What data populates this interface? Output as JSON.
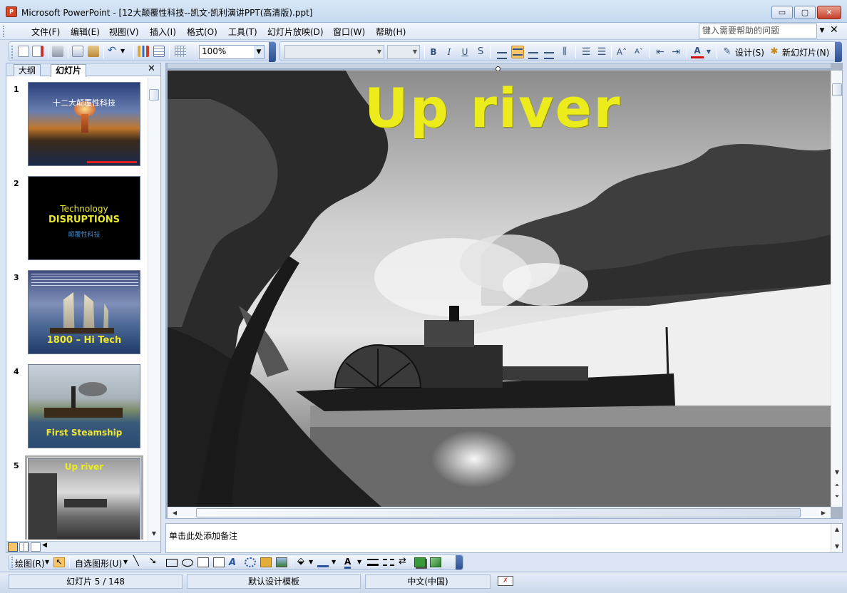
{
  "window": {
    "title": "Microsoft PowerPoint - [12大颠覆性科技--凯文·凯利演讲PPT(高清版).ppt]",
    "app_icon": "powerpoint-icon",
    "minimize_label": "▭",
    "maximize_label": "▢",
    "close_label": "✕"
  },
  "menubar": {
    "items": [
      "文件(F)",
      "编辑(E)",
      "视图(V)",
      "插入(I)",
      "格式(O)",
      "工具(T)",
      "幻灯片放映(D)",
      "窗口(W)",
      "帮助(H)"
    ],
    "help_placeholder": "键入需要帮助的问题",
    "close_label": "✕"
  },
  "toolbar_standard": {
    "zoom": "100%"
  },
  "toolbar_format": {
    "design_label": "设计(S)",
    "new_slide_label": "新幻灯片(N)"
  },
  "left_pane": {
    "tab_outline": "大纲",
    "tab_slides": "幻灯片",
    "close_label": "✕",
    "slides": [
      {
        "num": "1",
        "title": "十二大颠覆性科技"
      },
      {
        "num": "2",
        "title_line1": "Technology",
        "title_line2": "DISRUPTIONS",
        "subtitle": "颠覆性科技"
      },
      {
        "num": "3",
        "title": "1800 – Hi Tech"
      },
      {
        "num": "4",
        "title": "First Steamship"
      },
      {
        "num": "5",
        "title": "Up river"
      }
    ]
  },
  "slide": {
    "title": "Up river",
    "title_color": "#ecec1c"
  },
  "notes": {
    "placeholder": "单击此处添加备注"
  },
  "toolbar_drawing": {
    "draw_label": "绘图(R)",
    "autoshapes_label": "自选图形(U)"
  },
  "statusbar": {
    "slide_info": "幻灯片 5 / 148",
    "template": "默认设计模板",
    "language": "中文(中国)"
  }
}
